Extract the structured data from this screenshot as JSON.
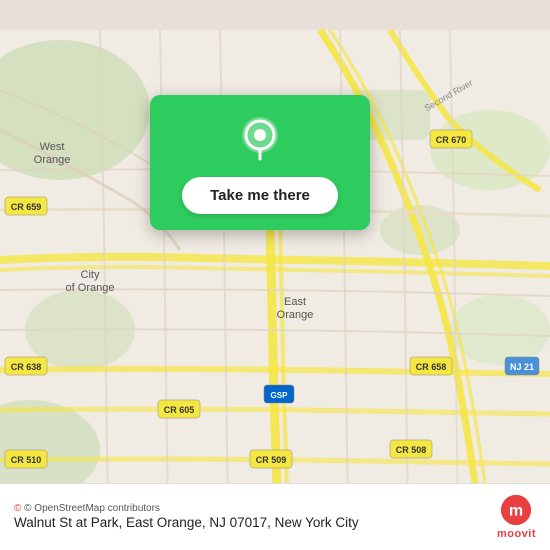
{
  "map": {
    "background_color": "#e8e0d8",
    "alt": "Map of East Orange, NJ area"
  },
  "location_card": {
    "button_label": "Take me there",
    "pin_color": "#ffffff",
    "card_color": "#2ecc5e"
  },
  "bottom_bar": {
    "address": "Walnut St at Park, East Orange, NJ 07017, New York City",
    "attribution": "© OpenStreetMap contributors",
    "logo_text": "moovit"
  }
}
